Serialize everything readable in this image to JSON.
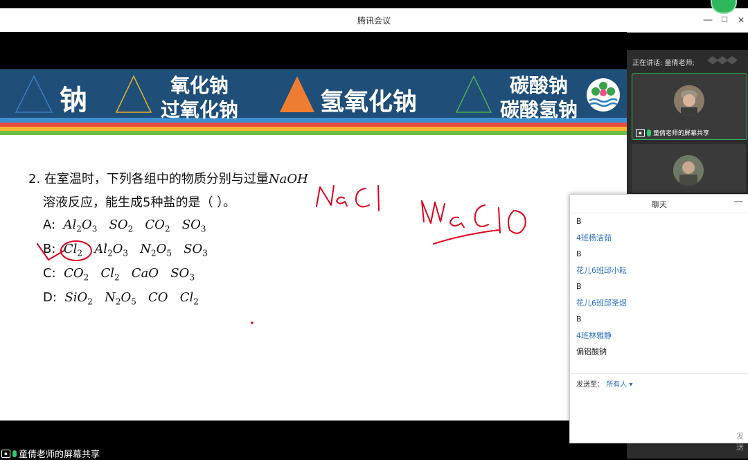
{
  "window": {
    "title": "腾讯会议",
    "minimize": "—",
    "maximize": "☐",
    "close": "✕"
  },
  "banner": {
    "item1": "钠",
    "item2a": "氧化钠",
    "item2b": "过氧化钠",
    "item3": "氢氧化钠",
    "item4a": "碳酸钠",
    "item4b": "碳酸氢钠"
  },
  "question": {
    "stem1": "2. 在室温时，下列各组中的物质分别与过量",
    "stem_formula": "NaOH",
    "stem2": "溶液反应，能生成5种盐的是（  ）。",
    "options": {
      "A": "A:",
      "B": "B:",
      "C": "C:",
      "D": "D:"
    }
  },
  "handwriting": {
    "note1": "NaCl",
    "note2": "NaClO"
  },
  "share_label": "童倩老师的屏幕共享",
  "panel": {
    "speaking": "正在讲话: 童倩老师;",
    "tile1_label": "童倩老师的屏幕共享"
  },
  "chat": {
    "title": "聊天",
    "minimize": "—",
    "messages": [
      {
        "kind": "t",
        "text": "B"
      },
      {
        "kind": "n",
        "text": "4班杨洁茹"
      },
      {
        "kind": "t",
        "text": "B"
      },
      {
        "kind": "n",
        "text": "花儿6班邱小耘"
      },
      {
        "kind": "t",
        "text": "B"
      },
      {
        "kind": "n",
        "text": "花儿6班邱圣煜"
      },
      {
        "kind": "t",
        "text": "B"
      },
      {
        "kind": "n",
        "text": "4班林雅静"
      },
      {
        "kind": "t",
        "text": "偏铝酸钠"
      }
    ],
    "send_to_label": "发送至：",
    "send_to_value": "所有人 ▾",
    "send_button": "发送"
  },
  "colors": {
    "banner_blue": "#1f4e79",
    "accent_green": "#2eb85c",
    "link_blue": "#2a6ec6",
    "ink_red": "#e0001a"
  }
}
